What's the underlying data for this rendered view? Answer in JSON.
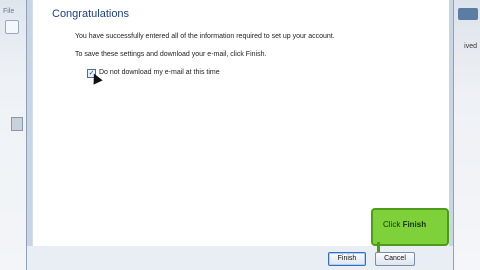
{
  "background_left": {
    "menu_label": "File"
  },
  "background_right": {
    "label": "ived"
  },
  "dialog": {
    "title": "Congratulations",
    "line1": "You have successfully entered all of the information required to set up your account.",
    "line2": "To save these settings and download your e-mail, click Finish.",
    "checkbox": {
      "label": "Do not download my e-mail at this time",
      "checked": true
    },
    "buttons": {
      "finish": "Finish",
      "cancel": "Cancel"
    }
  },
  "callout": {
    "prefix": "Click ",
    "emphasis": "Finish"
  }
}
